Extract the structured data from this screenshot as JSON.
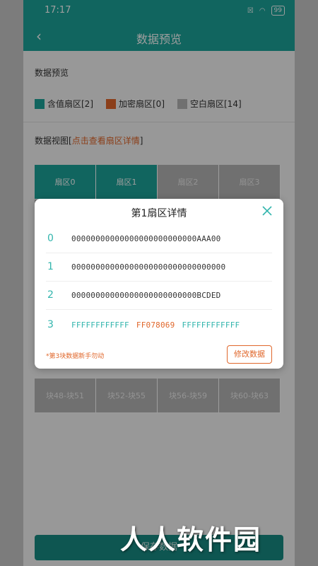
{
  "status": {
    "time": "17:17",
    "battery": "99"
  },
  "appbar": {
    "back": "‹",
    "title": "数据预览"
  },
  "preview": {
    "heading": "数据预览",
    "legend": [
      {
        "label": "含值扇区[2]",
        "color": "#1ca39a"
      },
      {
        "label": "加密扇区[0]",
        "color": "#e0672b"
      },
      {
        "label": "空白扇区[14]",
        "color": "#b5b5b5"
      }
    ]
  },
  "view": {
    "heading_prefix": "数据视图[",
    "heading_link": "点击查看扇区详情",
    "heading_suffix": "]"
  },
  "sectors_top": [
    "扇区0",
    "扇区1",
    "扇区2",
    "扇区3"
  ],
  "sectors_blocks": [
    "块48-块51",
    "块52-块55",
    "块56-块59",
    "块60-块63"
  ],
  "dialog": {
    "title": "第1扇区详情",
    "rows": [
      {
        "index": "0",
        "value": "00000000000000000000000000AAA00"
      },
      {
        "index": "1",
        "value": "00000000000000000000000000000000"
      },
      {
        "index": "2",
        "value": "00000000000000000000000000BCDED"
      },
      {
        "index": "3",
        "key_a": "FFFFFFFFFFFF",
        "access": "FF078069",
        "key_b": "FFFFFFFFFFFF"
      }
    ],
    "warning": "*第3块数据新手勿动",
    "edit_label": "修改数据"
  },
  "save_label": "保存数据",
  "watermark": "人人软件园"
}
